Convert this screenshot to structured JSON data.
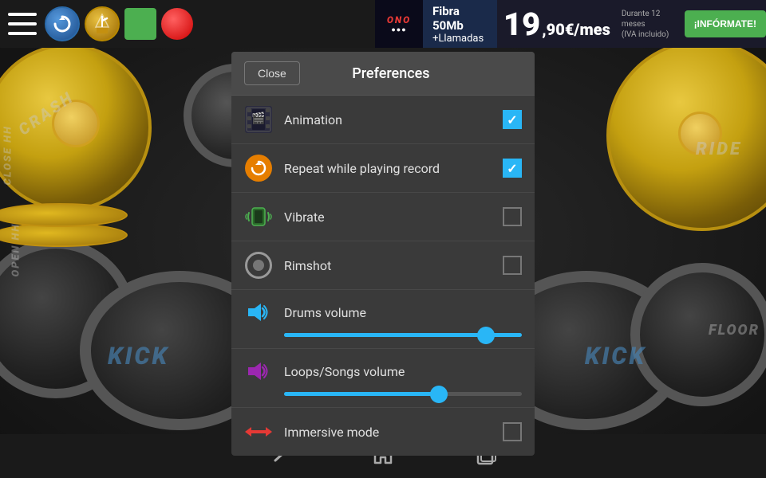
{
  "topbar": {
    "icons": {
      "menu": "☰",
      "refresh": "↺",
      "record": "⬤"
    }
  },
  "ad": {
    "brand": "ONO",
    "line1": "Fibra 50Mb",
    "line2": "+Llamadas",
    "price_integer": "19",
    "price_decimal": "90€/mes",
    "price_note": "Durante 12 meses\n(IVA incluido)",
    "cta": "¡INFÓRMATE!"
  },
  "bottombar": {
    "back": "←",
    "home": "⌂",
    "recent": "▭"
  },
  "modal": {
    "close_label": "Close",
    "title": "Preferences",
    "items": [
      {
        "id": "animation",
        "label": "Animation",
        "icon_type": "film",
        "checked": true
      },
      {
        "id": "repeat",
        "label": "Repeat while playing record",
        "icon_type": "repeat",
        "checked": true
      },
      {
        "id": "vibrate",
        "label": "Vibrate",
        "icon_type": "vibrate",
        "checked": false
      },
      {
        "id": "rimshot",
        "label": "Rimshot",
        "icon_type": "rimshot",
        "checked": false
      }
    ],
    "sliders": [
      {
        "id": "drums-volume",
        "label": "Drums volume",
        "icon_type": "volume-blue",
        "value": 85,
        "color": "#29b6f6"
      },
      {
        "id": "loops-volume",
        "label": "Loops/Songs volume",
        "icon_type": "volume-purple",
        "value": 65,
        "color": "#9c27b0"
      }
    ],
    "immersive": {
      "label": "Immersive mode",
      "icon_type": "arrows",
      "checked": false
    }
  },
  "background": {
    "labels": {
      "crash": "CRASH",
      "ride": "RIDE",
      "open_hh": "OPEN HH",
      "close_hh": "CLOSE HH",
      "kick_left": "KICK",
      "kick_right": "KICK",
      "floor": "FLOOR"
    }
  }
}
